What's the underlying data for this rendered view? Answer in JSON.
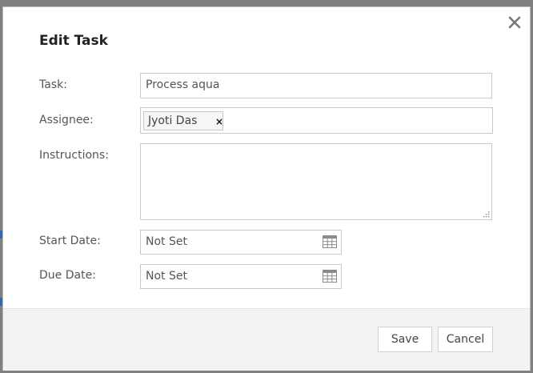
{
  "dialog": {
    "title": "Edit Task",
    "close_icon": "close-icon"
  },
  "form": {
    "task": {
      "label": "Task:",
      "value": "Process aqua"
    },
    "assignee": {
      "label": "Assignee:",
      "token": "Jyoti Das",
      "remove_glyph": "×"
    },
    "instructions": {
      "label": "Instructions:",
      "value": ""
    },
    "start_date": {
      "label": "Start Date:",
      "value": "Not Set",
      "icon": "calendar-icon"
    },
    "due_date": {
      "label": "Due Date:",
      "value": "Not Set",
      "icon": "calendar-icon"
    }
  },
  "footer": {
    "save_label": "Save",
    "cancel_label": "Cancel"
  }
}
